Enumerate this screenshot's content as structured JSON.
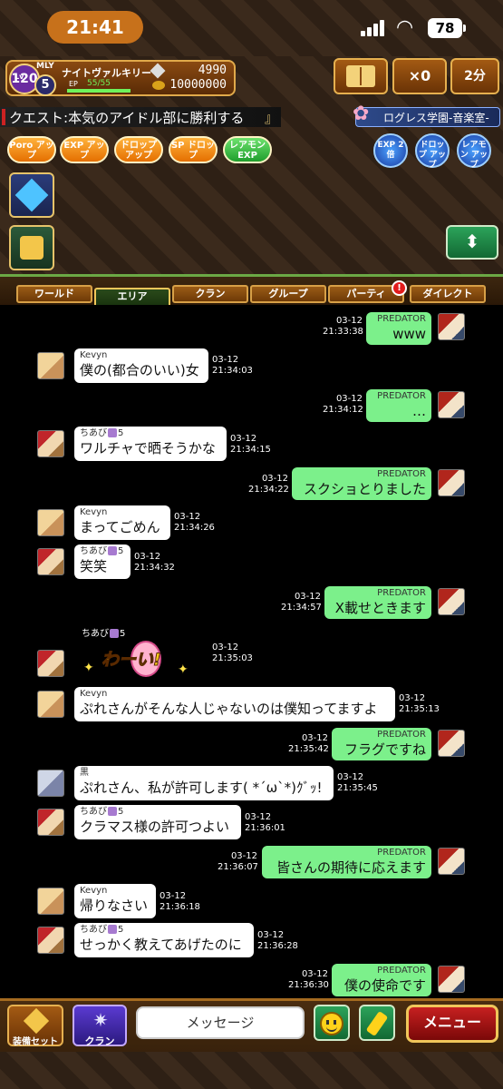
{
  "status_bar": {
    "time": "21:41",
    "battery": "78"
  },
  "player": {
    "lv_label": "Lv",
    "level": "120",
    "mly_label": "MLY",
    "mly": "5",
    "name": "ナイトヴァルキリー",
    "ep_label": "EP",
    "ep": "55/55",
    "ep_fraction": 1.0,
    "gems": "4990",
    "coins": "10000000"
  },
  "top_buttons": {
    "x0": "×0",
    "timer": "2分"
  },
  "quest": {
    "label": "クエスト:",
    "title": "本気のアイドル部に勝利する",
    "close_bracket": "』"
  },
  "location": {
    "name": "ログレス学園-音楽室-"
  },
  "boosts": [
    {
      "id": "poro",
      "label": "Poro アップ"
    },
    {
      "id": "exp",
      "label": "EXP アップ"
    },
    {
      "id": "drop",
      "label": "ドロップ アップ"
    },
    {
      "id": "sp",
      "label": "SP ドロップ"
    },
    {
      "id": "remon",
      "label": "レアモン EXP"
    }
  ],
  "round_boosts": [
    {
      "id": "exp2",
      "label": "EXP 2倍"
    },
    {
      "id": "dropup",
      "label": "ドロップ アップ"
    },
    {
      "id": "remonup",
      "label": "レアモン アップ"
    }
  ],
  "toggle_icon": "⬍",
  "tabs": [
    {
      "label": "ワールド"
    },
    {
      "label": "エリア"
    },
    {
      "label": "クラン"
    },
    {
      "label": "グループ"
    },
    {
      "label": "パーティ"
    },
    {
      "label": "ダイレクト"
    }
  ],
  "active_tab": "エリア",
  "party_alert": "!",
  "messages": [
    {
      "sender": "PREDATOR",
      "text": "www",
      "date": "03-12",
      "time": "21:33:38",
      "mine": true
    },
    {
      "sender": "Kevyn",
      "text": "僕の(都合のいい)女",
      "date": "03-12",
      "time": "21:34:03",
      "mine": false
    },
    {
      "sender": "PREDATOR",
      "text": "…",
      "date": "03-12",
      "time": "21:34:12",
      "mine": true
    },
    {
      "sender": "ちあび",
      "sender_suffix": "5",
      "text": "ワルチャで晒そうかな",
      "date": "03-12",
      "time": "21:34:15",
      "mine": false
    },
    {
      "sender": "PREDATOR",
      "text": "スクショとりました",
      "date": "03-12",
      "time": "21:34:22",
      "mine": true
    },
    {
      "sender": "Kevyn",
      "text": "まってごめん",
      "date": "03-12",
      "time": "21:34:26",
      "mine": false
    },
    {
      "sender": "ちあび",
      "sender_suffix": "5",
      "text": "笑笑",
      "date": "03-12",
      "time": "21:34:32",
      "mine": false
    },
    {
      "sender": "PREDATOR",
      "text": "X載せときます",
      "date": "03-12",
      "time": "21:34:57",
      "mine": true
    },
    {
      "sender": "ちあび",
      "sender_suffix": "5",
      "sticker": "わーい!",
      "date": "03-12",
      "time": "21:35:03",
      "mine": false
    },
    {
      "sender": "Kevyn",
      "text": "ぷれさんがそんな人じゃないのは僕知ってますよ",
      "date": "03-12",
      "time": "21:35:13",
      "mine": false
    },
    {
      "sender": "PREDATOR",
      "text": "フラグですね",
      "date": "03-12",
      "time": "21:35:42",
      "mine": true
    },
    {
      "sender": "黒",
      "text": "ぷれさん、私が許可します( *´ω`*)ｸﾞｯ!",
      "date": "03-12",
      "time": "21:35:45",
      "mine": false
    },
    {
      "sender": "ちあび",
      "sender_suffix": "5",
      "text": "クラマス様の許可つよい",
      "date": "03-12",
      "time": "21:36:01",
      "mine": false
    },
    {
      "sender": "PREDATOR",
      "text": "皆さんの期待に応えます",
      "date": "03-12",
      "time": "21:36:07",
      "mine": true
    },
    {
      "sender": "Kevyn",
      "text": "帰りなさい",
      "date": "03-12",
      "time": "21:36:18",
      "mine": false
    },
    {
      "sender": "ちあび",
      "sender_suffix": "5",
      "text": "せっかく教えてあげたのに",
      "date": "03-12",
      "time": "21:36:28",
      "mine": false
    },
    {
      "sender": "PREDATOR",
      "text": "僕の使命です",
      "date": "03-12",
      "time": "21:36:30",
      "mine": true
    }
  ],
  "bottom_bar": {
    "equip_label": "装備セット",
    "clan_label": "クラン",
    "message_placeholder": "メッセージ",
    "menu_label": "メニュー"
  }
}
